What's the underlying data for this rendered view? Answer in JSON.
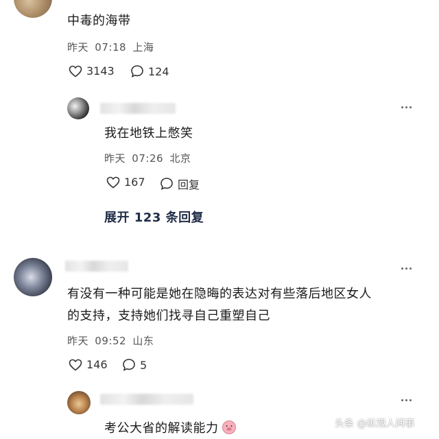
{
  "comments": [
    {
      "text": "中毒的海带",
      "date": "昨天",
      "time": "07:18",
      "location": "上海",
      "likes": "3143",
      "replies": "124"
    },
    {
      "text": "我在地铁上憋笑",
      "date": "昨天",
      "time": "07:26",
      "location": "北京",
      "likes": "167",
      "reply_label": "回复"
    },
    {
      "text_line1": "有没有一种可能是她在隐晦的表达对有些落后地区女人",
      "text_line2": "的支持，支持她们找寻自己重塑自己",
      "date": "昨天",
      "time": "09:52",
      "location": "山东",
      "likes": "146",
      "replies": "5"
    },
    {
      "text": "考公大省的解读能力",
      "emoji": "pig-face"
    }
  ],
  "expand_replies": "展开 123 条回复",
  "watermark": "头条 @纵观人间事",
  "colors": {
    "icon": "#333333",
    "meta": "#555555",
    "expand": "#1f2b46"
  }
}
